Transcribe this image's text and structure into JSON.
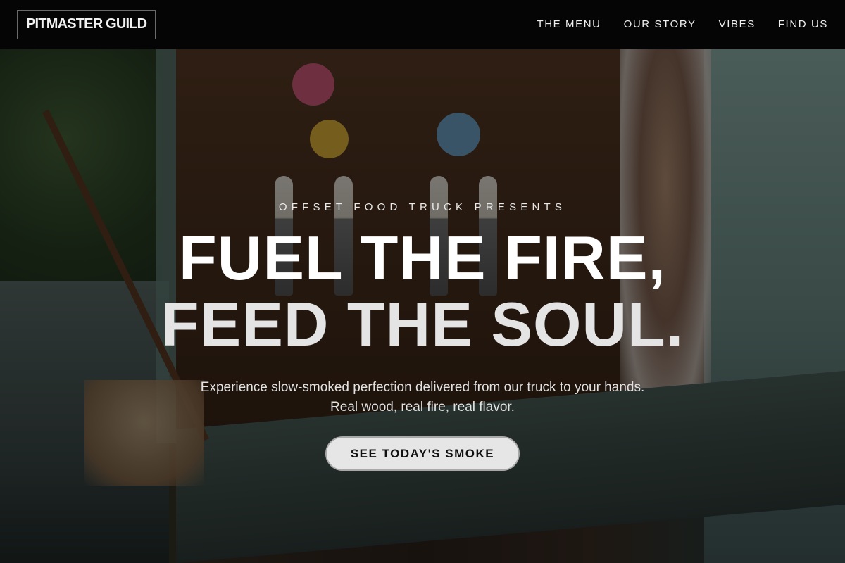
{
  "nav": {
    "logo": "PITMASTER GUILD",
    "links": [
      "THE MENU",
      "OUR STORY",
      "VIBES",
      "FIND US"
    ]
  },
  "hero": {
    "eyebrow": "OFFSET FOOD TRUCK PRESENTS",
    "headline_line1": "FUEL THE FIRE,",
    "headline_line2": "FEED THE SOUL.",
    "subtitle_line1": "Experience slow-smoked perfection delivered from our truck to your hands.",
    "subtitle_line2": "Real wood, real fire, real flavor.",
    "cta_label": "SEE TODAY'S SMOKE"
  },
  "colors": {
    "nav_bg": "#050505",
    "cta_bg": "#e6e6e6",
    "cta_text": "#111111"
  }
}
